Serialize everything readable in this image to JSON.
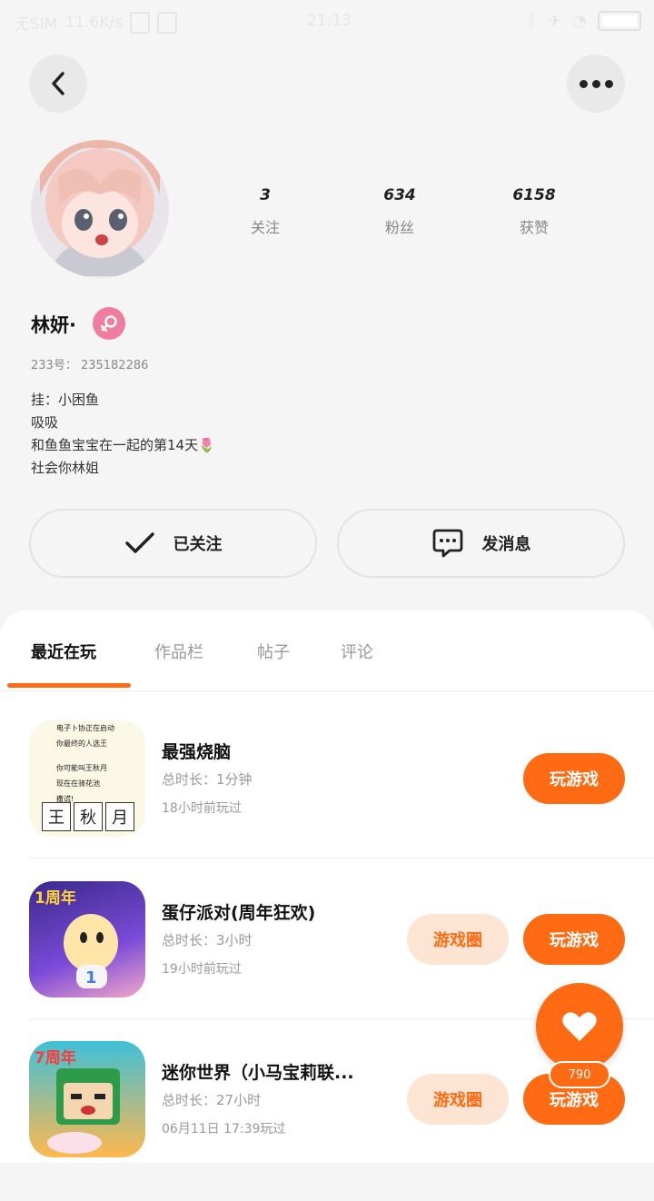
{
  "status_bar": {
    "carrier": "无SIM",
    "speed": "11.6K/s",
    "time": "21:13"
  },
  "profile": {
    "username": "林妍·",
    "id_line": "233号： 235182286",
    "bio": [
      "挂：小困鱼",
      "吸吸",
      "和鱼鱼宝宝在一起的第14天🌷",
      "社会你林姐"
    ],
    "stats": [
      {
        "value": "3",
        "label": "关注"
      },
      {
        "value": "634",
        "label": "粉丝"
      },
      {
        "value": "6158",
        "label": "获赞"
      }
    ]
  },
  "actions": {
    "follow_label": "已关注",
    "message_label": "发消息"
  },
  "tabs": [
    {
      "label": "最近在玩"
    },
    {
      "label": "作品栏"
    },
    {
      "label": "帖子"
    },
    {
      "label": "评论"
    }
  ],
  "games": [
    {
      "name": "最强烧脑",
      "duration": "总时长：1分钟",
      "last_played": "18小时前玩过",
      "play_label": "玩游戏",
      "icon_text": [
        "电子卜协正在启动",
        "你最终的人选王",
        "你可能叫王秋月",
        "现在在骑花池",
        "撒谎!"
      ],
      "icon_chars": [
        "王",
        "秋",
        "月"
      ]
    },
    {
      "name": "蛋仔派对(周年狂欢)",
      "duration": "总时长：3小时",
      "last_played": "19小时前玩过",
      "circle_label": "游戏圈",
      "play_label": "玩游戏",
      "icon_badge": "1周年"
    },
    {
      "name": "迷你世界（小马宝莉联...",
      "duration": "总时长：27小时",
      "last_played": "06月11日 17:39玩过",
      "circle_label": "游戏圈",
      "play_label": "玩游戏",
      "icon_badge": "7周年"
    }
  ],
  "like_fab": {
    "count": "790"
  },
  "colors": {
    "accent": "#ff6a13",
    "accent_light": "#fde4d3",
    "gender": "#f07ca0"
  }
}
